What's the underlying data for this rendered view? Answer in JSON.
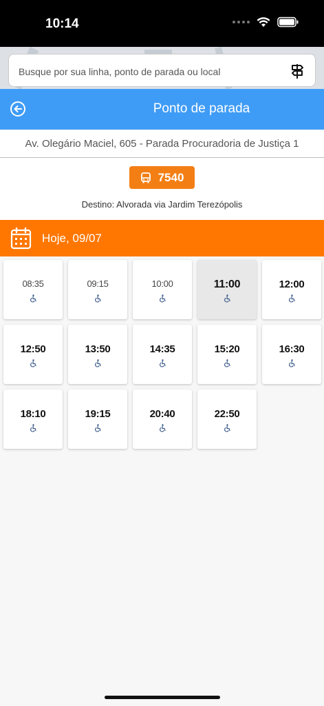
{
  "status_bar": {
    "time": "10:14"
  },
  "search": {
    "placeholder": "Busque por sua linha, ponto de parada ou local"
  },
  "header": {
    "title": "Ponto de parada"
  },
  "stop": {
    "name": "Av. Olegário Maciel, 605 - Parada Procuradoria de Justiça 1"
  },
  "line": {
    "number": "7540",
    "destination": "Destino: Alvorada via Jardim Terezópolis"
  },
  "date_bar": {
    "label": "Hoje, 09/07"
  },
  "colors": {
    "header_blue": "#3f9cf6",
    "accent_orange": "#ff7700",
    "badge_orange": "#f37f14",
    "icon_blue": "#3a5a8a"
  },
  "departures": [
    {
      "time": "08:35",
      "accessible": true,
      "state": "past"
    },
    {
      "time": "09:15",
      "accessible": true,
      "state": "past"
    },
    {
      "time": "10:00",
      "accessible": true,
      "state": "past"
    },
    {
      "time": "11:00",
      "accessible": true,
      "state": "next"
    },
    {
      "time": "12:00",
      "accessible": true,
      "state": "upcoming"
    },
    {
      "time": "12:50",
      "accessible": true,
      "state": "upcoming"
    },
    {
      "time": "13:50",
      "accessible": true,
      "state": "upcoming"
    },
    {
      "time": "14:35",
      "accessible": true,
      "state": "upcoming"
    },
    {
      "time": "15:20",
      "accessible": true,
      "state": "upcoming"
    },
    {
      "time": "16:30",
      "accessible": true,
      "state": "upcoming"
    },
    {
      "time": "18:10",
      "accessible": true,
      "state": "upcoming"
    },
    {
      "time": "19:15",
      "accessible": true,
      "state": "upcoming"
    },
    {
      "time": "20:40",
      "accessible": true,
      "state": "upcoming"
    },
    {
      "time": "22:50",
      "accessible": true,
      "state": "upcoming"
    }
  ]
}
